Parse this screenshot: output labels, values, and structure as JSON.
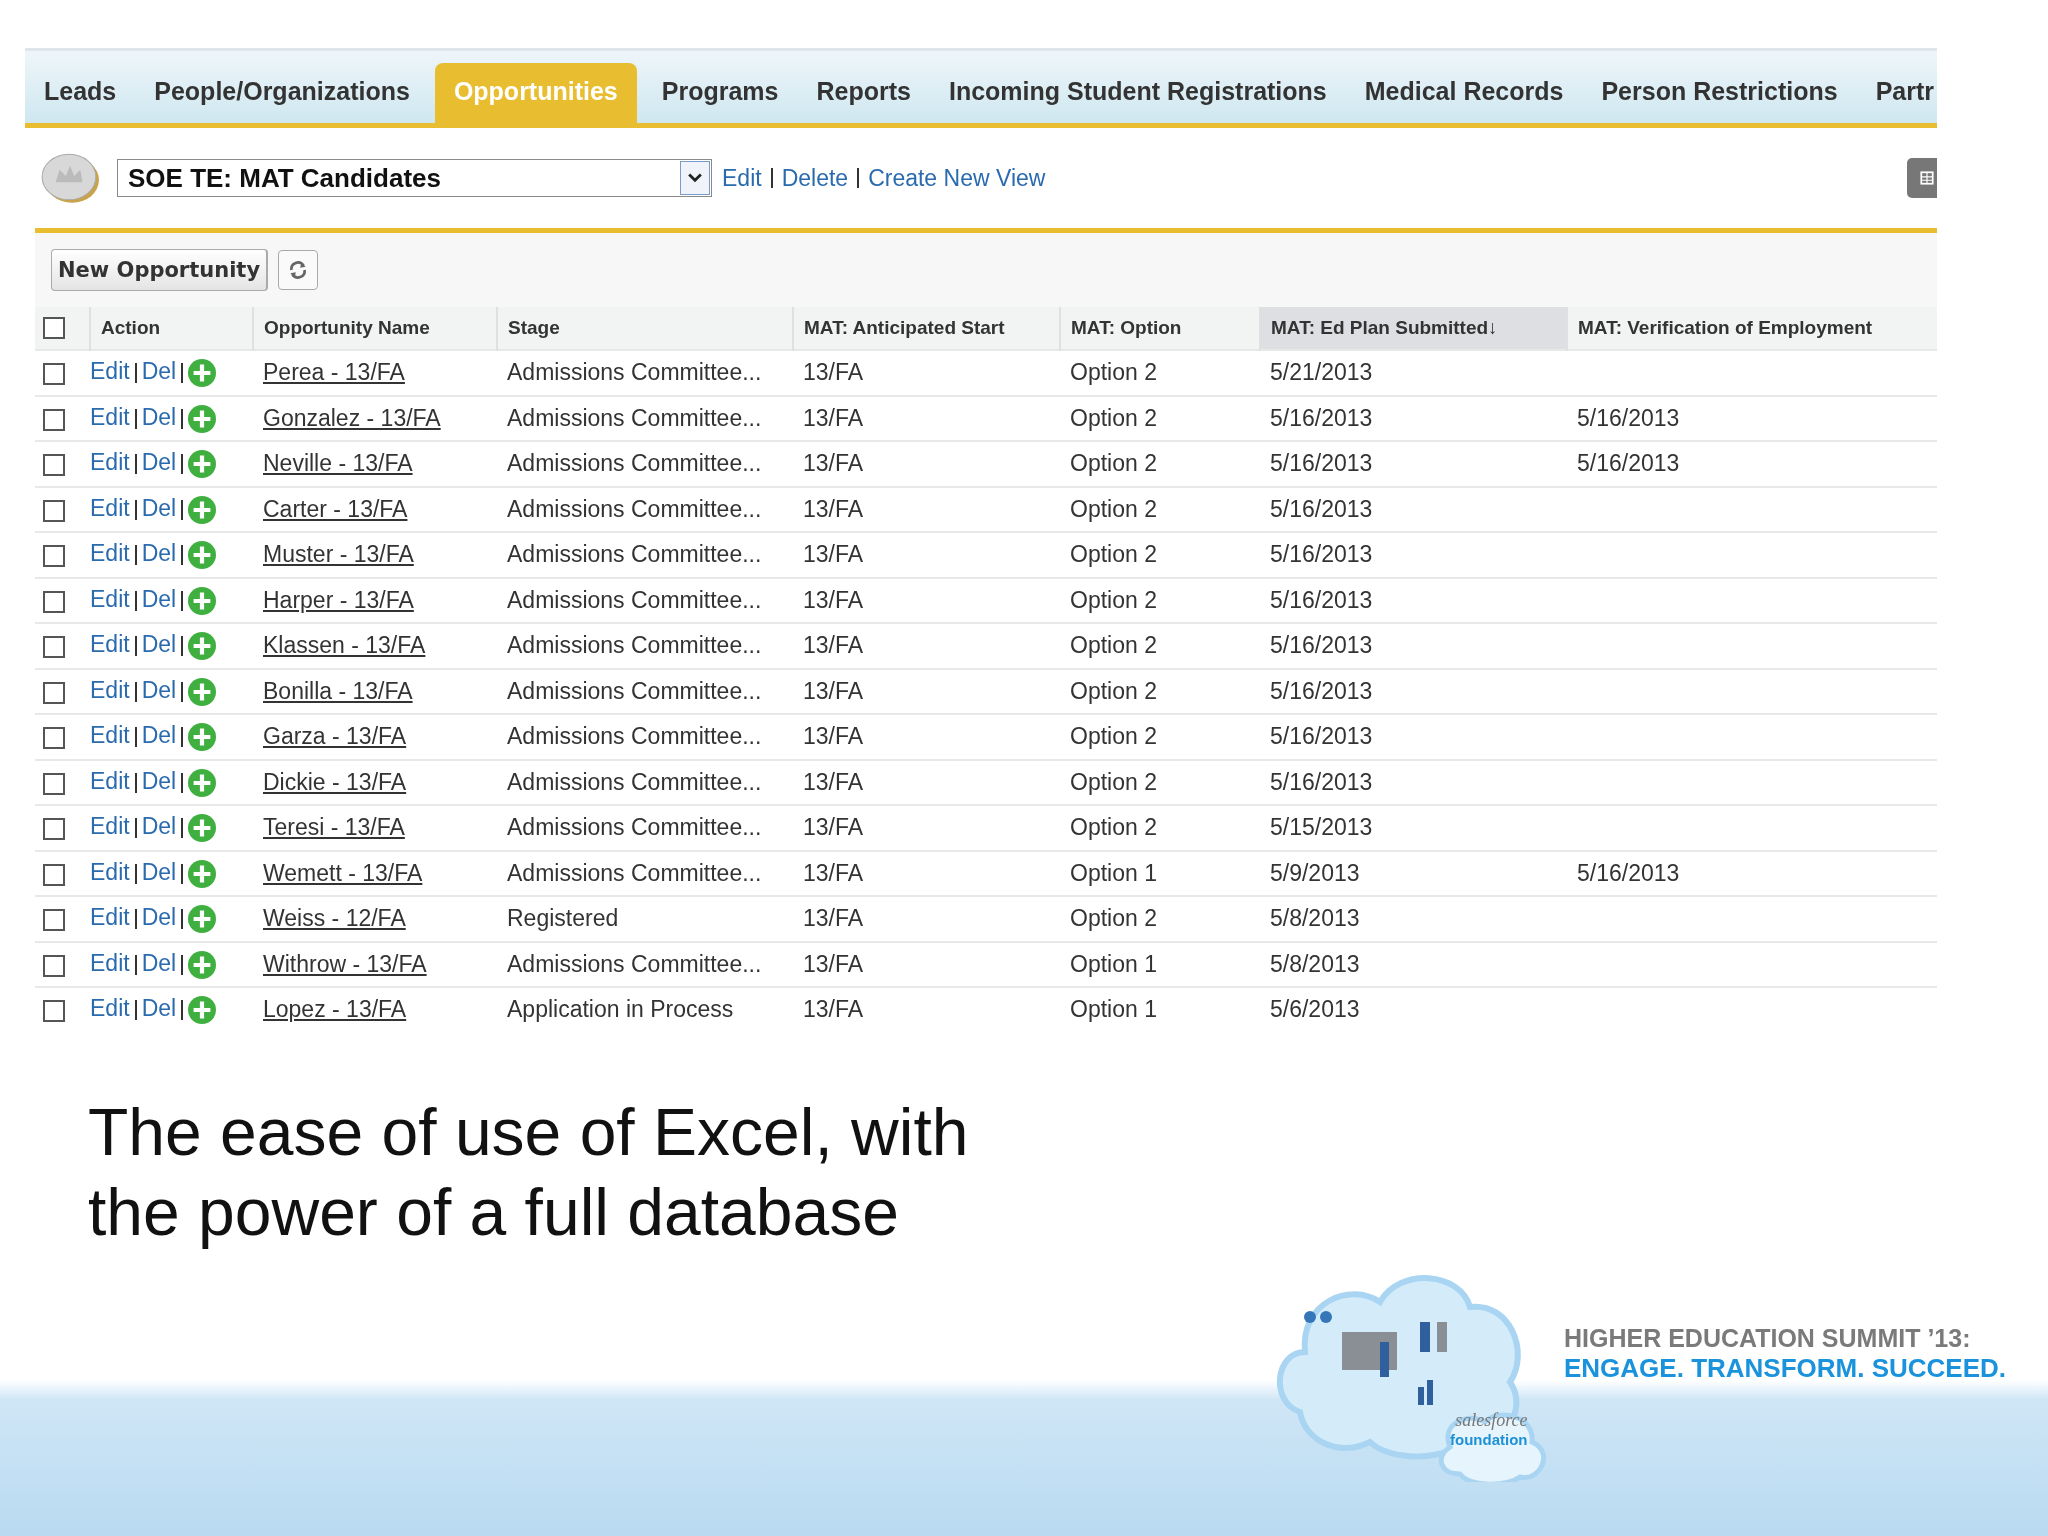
{
  "tabs": [
    {
      "label": "Leads",
      "selected": false
    },
    {
      "label": "People/Organizations",
      "selected": false
    },
    {
      "label": "Opportunities",
      "selected": true
    },
    {
      "label": "Programs",
      "selected": false
    },
    {
      "label": "Reports",
      "selected": false
    },
    {
      "label": "Incoming Student Registrations",
      "selected": false
    },
    {
      "label": "Medical Records",
      "selected": false
    },
    {
      "label": "Person Restrictions",
      "selected": false
    },
    {
      "label": "Partr",
      "selected": false
    }
  ],
  "view": {
    "value": "SOE TE: MAT Candidates",
    "links": [
      "Edit",
      "Delete",
      "Create New View"
    ]
  },
  "toolbar": {
    "new_button": "New Opportunity"
  },
  "table": {
    "columns": [
      {
        "label": "Action",
        "sorted": false
      },
      {
        "label": "Opportunity Name",
        "sorted": false
      },
      {
        "label": "Stage",
        "sorted": false
      },
      {
        "label": "MAT: Anticipated Start",
        "sorted": false
      },
      {
        "label": "MAT: Option",
        "sorted": false
      },
      {
        "label": "MAT: Ed Plan Submitted",
        "sorted": true,
        "sort_mark": "↓"
      },
      {
        "label": "MAT: Verification of Employment",
        "sorted": false
      }
    ],
    "select_all_checked": false,
    "rows": [
      {
        "checked": false,
        "actions": [
          "Edit",
          "Del"
        ],
        "name": "Perea - 13/FA",
        "stage": "Admissions Committee...",
        "start": "13/FA",
        "option": "Option 2",
        "ed_plan": "5/21/2013"
      },
      {
        "checked": false,
        "actions": [
          "Edit",
          "Del"
        ],
        "name": "Gonzalez - 13/FA",
        "stage": "Admissions Committee...",
        "start": "13/FA",
        "option": "Option 2",
        "ed_plan": "5/16/2013",
        "verification": "5/16/2013"
      },
      {
        "checked": false,
        "actions": [
          "Edit",
          "Del"
        ],
        "name": "Neville - 13/FA",
        "stage": "Admissions Committee...",
        "start": "13/FA",
        "option": "Option 2",
        "ed_plan": "5/16/2013",
        "verification": "5/16/2013"
      },
      {
        "checked": false,
        "actions": [
          "Edit",
          "Del"
        ],
        "name": "Carter - 13/FA",
        "stage": "Admissions Committee...",
        "start": "13/FA",
        "option": "Option 2",
        "ed_plan": "5/16/2013"
      },
      {
        "checked": false,
        "actions": [
          "Edit",
          "Del"
        ],
        "name": "Muster - 13/FA",
        "stage": "Admissions Committee...",
        "start": "13/FA",
        "option": "Option 2",
        "ed_plan": "5/16/2013"
      },
      {
        "checked": false,
        "actions": [
          "Edit",
          "Del"
        ],
        "name": "Harper - 13/FA",
        "stage": "Admissions Committee...",
        "start": "13/FA",
        "option": "Option 2",
        "ed_plan": "5/16/2013"
      },
      {
        "checked": false,
        "actions": [
          "Edit",
          "Del"
        ],
        "name": "Klassen - 13/FA",
        "stage": "Admissions Committee...",
        "start": "13/FA",
        "option": "Option 2",
        "ed_plan": "5/16/2013"
      },
      {
        "checked": false,
        "actions": [
          "Edit",
          "Del"
        ],
        "name": "Bonilla - 13/FA",
        "stage": "Admissions Committee...",
        "start": "13/FA",
        "option": "Option 2",
        "ed_plan": "5/16/2013"
      },
      {
        "checked": false,
        "actions": [
          "Edit",
          "Del"
        ],
        "name": "Garza - 13/FA",
        "stage": "Admissions Committee...",
        "start": "13/FA",
        "option": "Option 2",
        "ed_plan": "5/16/2013"
      },
      {
        "checked": false,
        "actions": [
          "Edit",
          "Del"
        ],
        "name": "Dickie - 13/FA",
        "stage": "Admissions Committee...",
        "start": "13/FA",
        "option": "Option 2",
        "ed_plan": "5/16/2013"
      },
      {
        "checked": false,
        "actions": [
          "Edit",
          "Del"
        ],
        "name": "Teresi - 13/FA",
        "stage": "Admissions Committee...",
        "start": "13/FA",
        "option": "Option 2",
        "ed_plan": "5/15/2013"
      },
      {
        "checked": false,
        "actions": [
          "Edit",
          "Del"
        ],
        "name": "Wemett - 13/FA",
        "stage": "Admissions Committee...",
        "start": "13/FA",
        "option": "Option 1",
        "ed_plan": "5/9/2013",
        "verification": "5/16/2013"
      },
      {
        "checked": false,
        "actions": [
          "Edit",
          "Del"
        ],
        "name": "Weiss - 12/FA",
        "stage": "Registered",
        "start": "13/FA",
        "option": "Option 2",
        "ed_plan": "5/8/2013"
      },
      {
        "checked": false,
        "actions": [
          "Edit",
          "Del"
        ],
        "name": "Withrow - 13/FA",
        "stage": "Admissions Committee...",
        "start": "13/FA",
        "option": "Option 1",
        "ed_plan": "5/8/2013"
      },
      {
        "checked": false,
        "actions": [
          "Edit",
          "Del"
        ],
        "name": "Lopez - 13/FA",
        "stage": "Application in Process",
        "start": "13/FA",
        "option": "Option 1",
        "ed_plan": "5/6/2013"
      }
    ]
  },
  "caption": [
    "The ease of use of Excel, with",
    "the power of a full database"
  ],
  "footer": {
    "logo_lines": [
      "salesforce",
      "foundation"
    ],
    "event_title": "HIGHER EDUCATION SUMMIT ’13:",
    "tagline": "ENGAGE. TRANSFORM. SUCCEED."
  }
}
